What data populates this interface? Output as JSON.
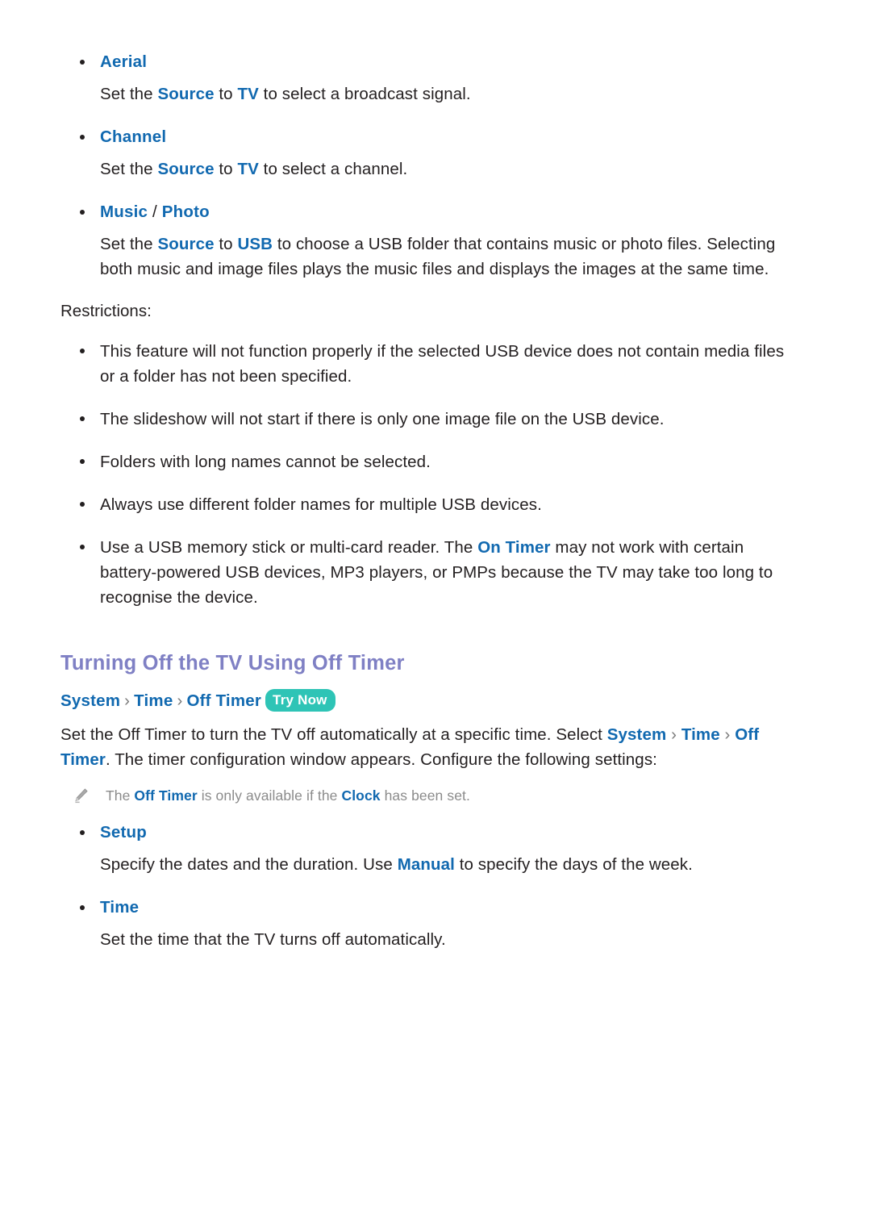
{
  "document": {
    "accent_blue": "#1169b0",
    "heading_purple": "#7f80c4",
    "badge_teal": "#2ec4b6",
    "note_gray": "#8b8b8b"
  },
  "sections": {
    "timer_options": {
      "items": [
        {
          "label": "Aerial",
          "desc_prefix": "Set the ",
          "desc_link1": "Source",
          "desc_mid": " to ",
          "desc_link2": "TV",
          "desc_suffix": " to select a broadcast signal."
        },
        {
          "label": "Channel",
          "desc_prefix": "Set the ",
          "desc_link1": "Source",
          "desc_mid": " to ",
          "desc_link2": "TV",
          "desc_suffix": " to select a channel."
        },
        {
          "label_part1": "Music",
          "label_slash": " / ",
          "label_part2": "Photo",
          "desc_prefix": "Set the ",
          "desc_link1": "Source",
          "desc_mid": " to ",
          "desc_link2": "USB",
          "desc_suffix": " to choose a USB folder that contains music or photo files. Selecting both music and image files plays the music files and displays the images at the same time."
        }
      ]
    },
    "restrictions": {
      "title": "Restrictions:",
      "items": [
        "This feature will not function properly if the selected USB device does not contain media files or a folder has not been specified.",
        "The slideshow will not start if there is only one image file on the USB device.",
        "Folders with long names cannot be selected.",
        "Always use different folder names for multiple USB devices."
      ],
      "usb_item": {
        "prefix": "Use a USB memory stick or multi-card reader. The ",
        "link": "On Timer",
        "suffix": " may not work with certain battery-powered USB devices, MP3 players, or PMPs because the TV may take too long to recognise the device."
      }
    },
    "off_timer": {
      "heading": "Turning Off the TV Using Off Timer",
      "breadcrumb": {
        "item1": "System",
        "sep1": "›",
        "item2": "Time",
        "sep2": "›",
        "item3": "Off Timer",
        "badge": "Try Now"
      },
      "intro": {
        "prefix": "Set the Off Timer to turn the TV off automatically at a specific time. Select ",
        "link1": "System",
        "sep1": "›",
        "link2": "Time",
        "sep2": "›",
        "link3": "Off Timer",
        "suffix": ". The timer configuration window appears. Configure the following settings:"
      },
      "note": {
        "icon": "pencil-icon",
        "prefix": "The ",
        "link1": "Off Timer",
        "mid": " is only available if the ",
        "link2": "Clock",
        "suffix": " has been set."
      },
      "items": [
        {
          "label": "Setup",
          "desc_prefix": "Specify the dates and the duration. Use ",
          "desc_link": "Manual",
          "desc_suffix": " to specify the days of the week."
        },
        {
          "label": "Time",
          "desc_prefix": "Set the time that the TV turns off automatically.",
          "desc_link": "",
          "desc_suffix": ""
        }
      ]
    }
  }
}
